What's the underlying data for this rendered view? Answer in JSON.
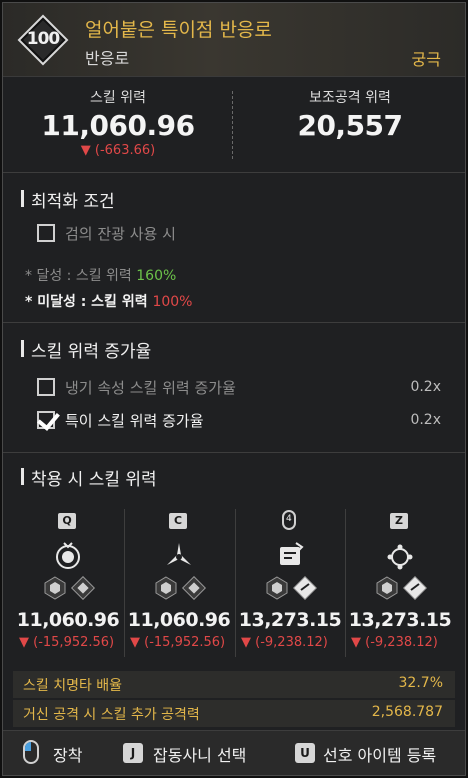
{
  "header": {
    "level": "100",
    "name": "얼어붙은 특이점 반응로",
    "type": "반응로",
    "grade": "궁극"
  },
  "stats": {
    "skill_power_label": "스킬 위력",
    "skill_power_value": "11,060.96",
    "skill_power_diff": "▼ (-663.66)",
    "support_power_label": "보조공격 위력",
    "support_power_value": "20,557"
  },
  "optimization": {
    "title": "최적화 조건",
    "condition": "검의 잔광 사용 시",
    "achieved_prefix": "* 달성 : 스킬 위력",
    "achieved_value": "160%",
    "not_achieved_prefix": "* 미달성 : 스킬 위력",
    "not_achieved_value": "100%"
  },
  "multipliers": {
    "title": "스킬 위력 증가율",
    "rows": [
      {
        "label": "냉기 속성 스킬 위력 증가율",
        "value": "0.2x",
        "checked": false
      },
      {
        "label": "특이 스킬 위력 증가율",
        "value": "0.2x",
        "checked": true
      }
    ]
  },
  "equipped": {
    "title": "착용 시 스킬 위력",
    "skills": [
      {
        "key": "Q",
        "value": "11,060.96",
        "diff": "▼ (-15,952.56)"
      },
      {
        "key": "C",
        "value": "11,060.96",
        "diff": "▼ (-15,952.56)"
      },
      {
        "key": "mouse-4",
        "value": "13,273.15",
        "diff": "▼ (-9,238.12)"
      },
      {
        "key": "Z",
        "value": "13,273.15",
        "diff": "▼ (-9,238.12)"
      }
    ]
  },
  "info_rows": [
    {
      "label": "스킬 치명타 배율",
      "value": "32.7%"
    },
    {
      "label": "거신 공격 시 스킬 추가 공격력",
      "value": "2,568.787"
    }
  ],
  "footer": {
    "equip_label": "장착",
    "j_key": "J",
    "j_label": "잡동사니 선택",
    "u_key": "U",
    "u_label": "선호 아이템 등록"
  },
  "colors": {
    "gold": "#e3b74a",
    "red": "#e04848",
    "green": "#6cc24a"
  }
}
